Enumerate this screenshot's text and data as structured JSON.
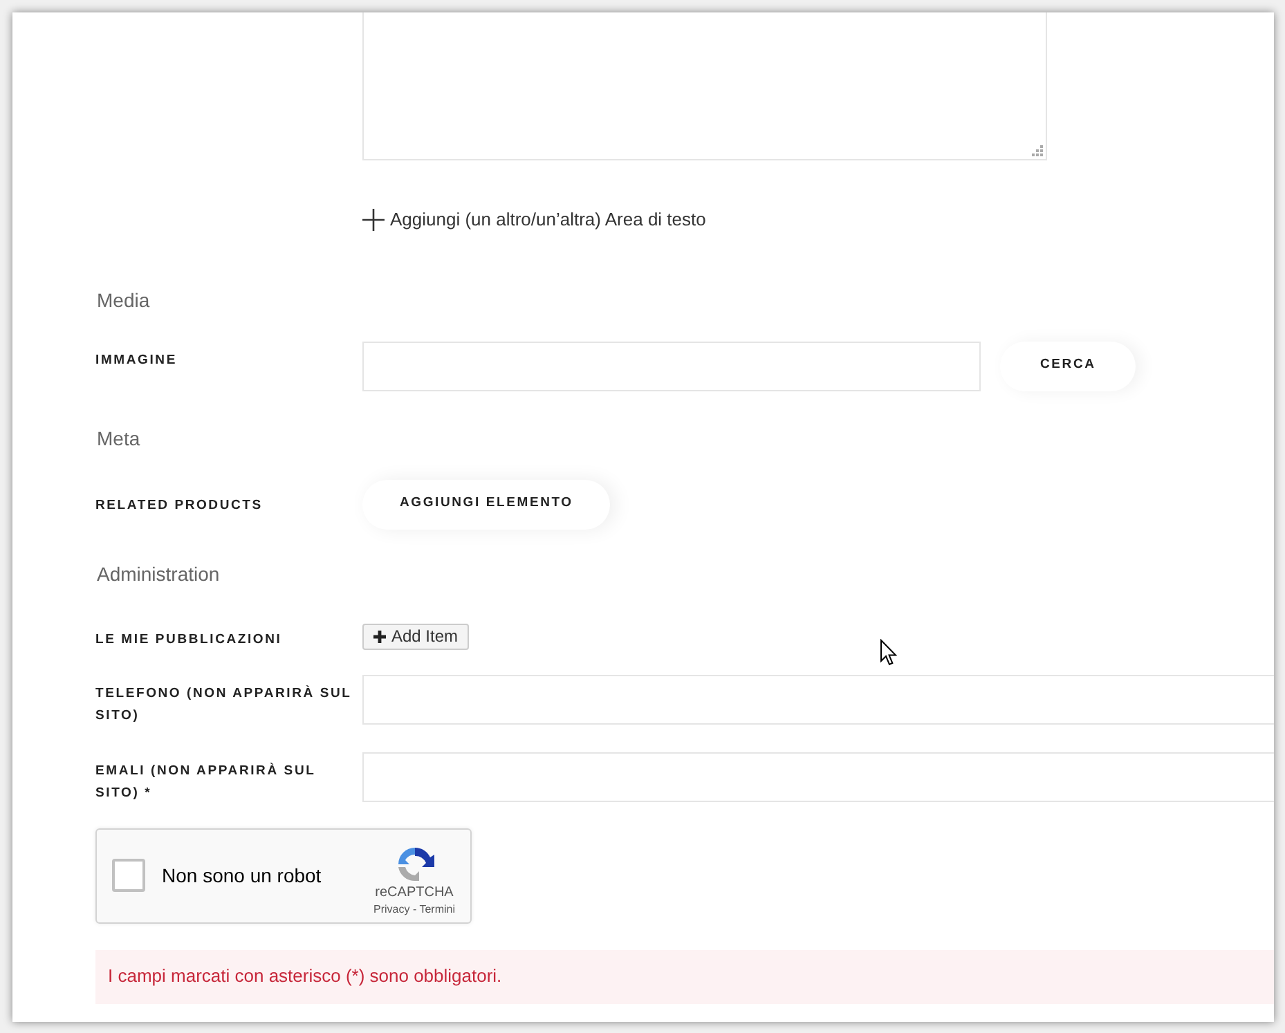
{
  "add_textarea_link": "Aggiungi (un altro/un’altra) Area di testo",
  "sections": [
    {
      "title": "Media",
      "fields": [
        {
          "kind": "file",
          "label": "IMMAGINE",
          "button": "CERCA"
        }
      ]
    },
    {
      "title": "Meta",
      "fields": [
        {
          "kind": "list",
          "label": "RELATED PRODUCTS",
          "button": "AGGIUNGI ELEMENTO"
        }
      ]
    },
    {
      "title": "Administration",
      "fields": [
        {
          "kind": "repeater",
          "label": "LE MIE PUBBLICAZIONI",
          "button": "Add Item"
        },
        {
          "kind": "text",
          "label": "TELEFONO (NON APPARIRÀ SUL SITO)"
        },
        {
          "kind": "text",
          "label": "EMALI (NON APPARIRÀ SUL SITO) *"
        }
      ]
    }
  ],
  "captcha": {
    "checked": false,
    "label": "Non sono un robot",
    "brand": "reCAPTCHA",
    "links": "Privacy - Termini"
  },
  "notice": "I campi marcati con asterisco (*) sono obbligatori."
}
